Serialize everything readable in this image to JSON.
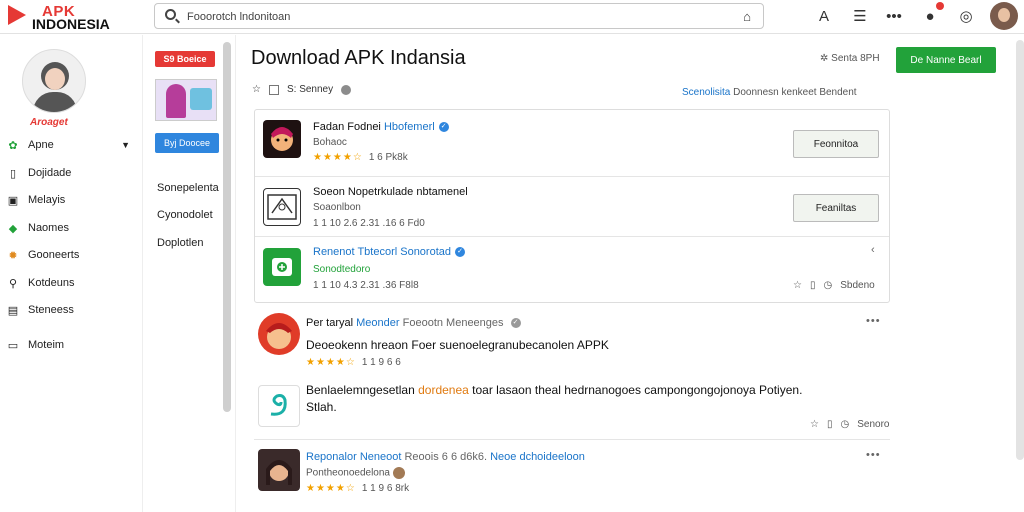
{
  "brand": {
    "line1": "APK",
    "line2": "INDONESIA"
  },
  "search": {
    "value": "Fooorotch lndonitoan"
  },
  "sidebar": {
    "brand_text": "Aroaget",
    "items": [
      {
        "label": "Apne",
        "icon": "gear-icon",
        "icon_color": "#22a23a",
        "expanded": true
      },
      {
        "label": "Dojidade",
        "icon": "document-icon"
      },
      {
        "label": "Melayis",
        "icon": "image-icon"
      },
      {
        "label": "Naomes",
        "icon": "leaf-icon",
        "icon_color": "#22a23a"
      },
      {
        "label": "Gooneerts",
        "icon": "settings-icon",
        "icon_color": "#e08a1e"
      },
      {
        "label": "Kotdeuns",
        "icon": "search-icon"
      },
      {
        "label": "Steneess",
        "icon": "list-icon"
      },
      {
        "label": "Moteim",
        "icon": "folder-icon"
      }
    ]
  },
  "mid": {
    "badge": "S9 Boeice",
    "button": "Byj Doocee",
    "links": [
      "Sonepelenta",
      "Cyonodolet",
      "Doplotlen"
    ]
  },
  "main": {
    "title": "Download APK Indansia",
    "share": "Senta 8PH",
    "download_button": "De Nanne Bearl",
    "filter_label": "S: Senney",
    "sort": {
      "active": "Scenolisita",
      "rest": "Doonnesn kenkeet Bendent"
    }
  },
  "apps": [
    {
      "title": "Fadan Fodnei",
      "title_blue": "Hbofemerl",
      "verified": true,
      "sub": "Bohaoc",
      "stars": "★★★★☆",
      "rating": "1 6 Pk8k",
      "button": "Feonnitoa",
      "icon_color": "#2b1a1a"
    },
    {
      "title": "Soeon Nopetrkulade nbtamenel",
      "title_blue": "",
      "verified": false,
      "sub": "Soaonlbon",
      "stars": "",
      "rating": "1 1 10 2.6 2.31 .16 6 Fd0",
      "button": "Feaniltas",
      "icon_color": "#ffffff"
    },
    {
      "title": "Renenot Tbtecorl Sonorotad",
      "title_blue": "",
      "verified": true,
      "sub": "Sonodtedoro",
      "stars": "",
      "rating": "1 1 10 4.3 2.31 .36 F8l8",
      "meta": "Sbdeno",
      "icon_color": "#22a23a"
    }
  ],
  "reviews": [
    {
      "name": "Per taryal",
      "name_blue": "Meonder",
      "name_gray": "Foeootn Meneenges",
      "text": "Deoeokenn hreaon Foer suenoelegranubecanolen APPK",
      "stars": "★★★★☆",
      "rating": "1 1 9 6 6"
    },
    {
      "name": "Benlaelemngesetlan",
      "name_blue": "",
      "name_orange": "dordenea",
      "text_rest": "toar lasaon theal hedrnanogoes campongongojonoya Potiyen.",
      "text2": "Stlah.",
      "meta": "Senoro",
      "avatar_color": "#1bb0a8"
    },
    {
      "name": "",
      "name_blue": "Reponalor Neneoot",
      "name_gray": "Reoois 6 6 d6k6.",
      "name_blue2": "Neoe dchoideeloon",
      "sub": "Pontheonoedelona",
      "stars": "★★★★☆",
      "rating": "1 1 9 6 8rk"
    }
  ],
  "colors": {
    "accent": "#22a23a",
    "brand": "#e53935",
    "link": "#1a74c9"
  }
}
